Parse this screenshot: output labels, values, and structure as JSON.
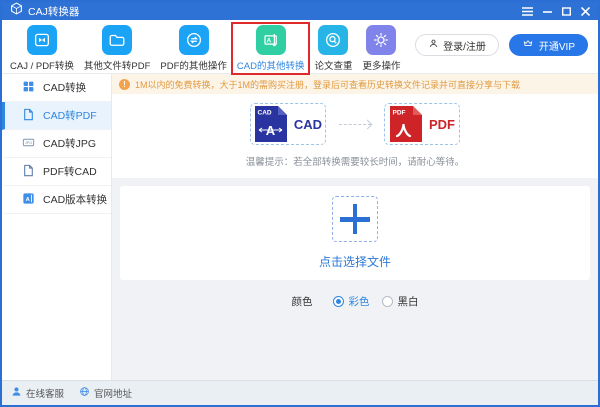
{
  "window": {
    "title": "CAJ转换器"
  },
  "toolbar": {
    "items": [
      {
        "label": "CAJ / PDF转换",
        "icon": "pdf-convert-icon",
        "color": "#1BA3F5"
      },
      {
        "label": "其他文件转PDF",
        "icon": "folder-to-pdf-icon",
        "color": "#1BA3F5"
      },
      {
        "label": "PDF的其他操作",
        "icon": "pdf-operations-sync-icon",
        "color": "#1BA3F5"
      },
      {
        "label": "CAD的其他转换",
        "icon": "cad-convert-icon",
        "color": "#2FCFA3",
        "highlighted": true
      },
      {
        "label": "论文查重",
        "icon": "plagiarism-check-icon",
        "color": "#27B5E8"
      },
      {
        "label": "更多操作",
        "icon": "gear-icon",
        "color": "#8083EA"
      }
    ],
    "login_label": "登录/注册",
    "vip_label": "开通VIP"
  },
  "notice": {
    "text": "1M以内的免费转换，大于1M的需购买注册，登录后可查看历史转换文件记录并可直接分享与下载"
  },
  "sidebar": {
    "items": [
      {
        "label": "CAD转换",
        "icon": "grid-icon",
        "active": false
      },
      {
        "label": "CAD转PDF",
        "icon": "pdf-file-icon",
        "active": true
      },
      {
        "label": "CAD转JPG",
        "icon": "jpg-file-icon",
        "active": false
      },
      {
        "label": "PDF转CAD",
        "icon": "pdf-file-icon",
        "active": false
      },
      {
        "label": "CAD版本转换",
        "icon": "cad-badge-icon",
        "active": false
      }
    ]
  },
  "main": {
    "source_format": "CAD",
    "target_format": "PDF",
    "source_badge": "CAD",
    "target_badge": "PDF",
    "source_glyph": "A",
    "tip": "温馨提示：若全部转换需要较长时间，请耐心等待。",
    "select_file_label": "点击选择文件",
    "color_label": "颜色",
    "color_options": [
      {
        "label": "彩色",
        "selected": true
      },
      {
        "label": "黑白",
        "selected": false
      }
    ]
  },
  "statusbar": {
    "links": [
      {
        "label": "在线客服",
        "icon": "support-person-icon"
      },
      {
        "label": "官网地址",
        "icon": "globe-icon"
      }
    ]
  },
  "colors": {
    "titlebar_blue": "#2E72D6",
    "accent_blue": "#2E86E0",
    "icon_blue": "#1BA3F5",
    "icon_green": "#2FCFA3",
    "icon_cyan": "#27B5E8",
    "icon_purple": "#8083EA",
    "vip_button_blue": "#2877E8",
    "highlight_red": "#DE2A2A",
    "notice_bg": "#FDF4E8",
    "notice_text": "#E09A40",
    "cad_navy": "#2A34A0",
    "pdf_red": "#CE2428"
  }
}
